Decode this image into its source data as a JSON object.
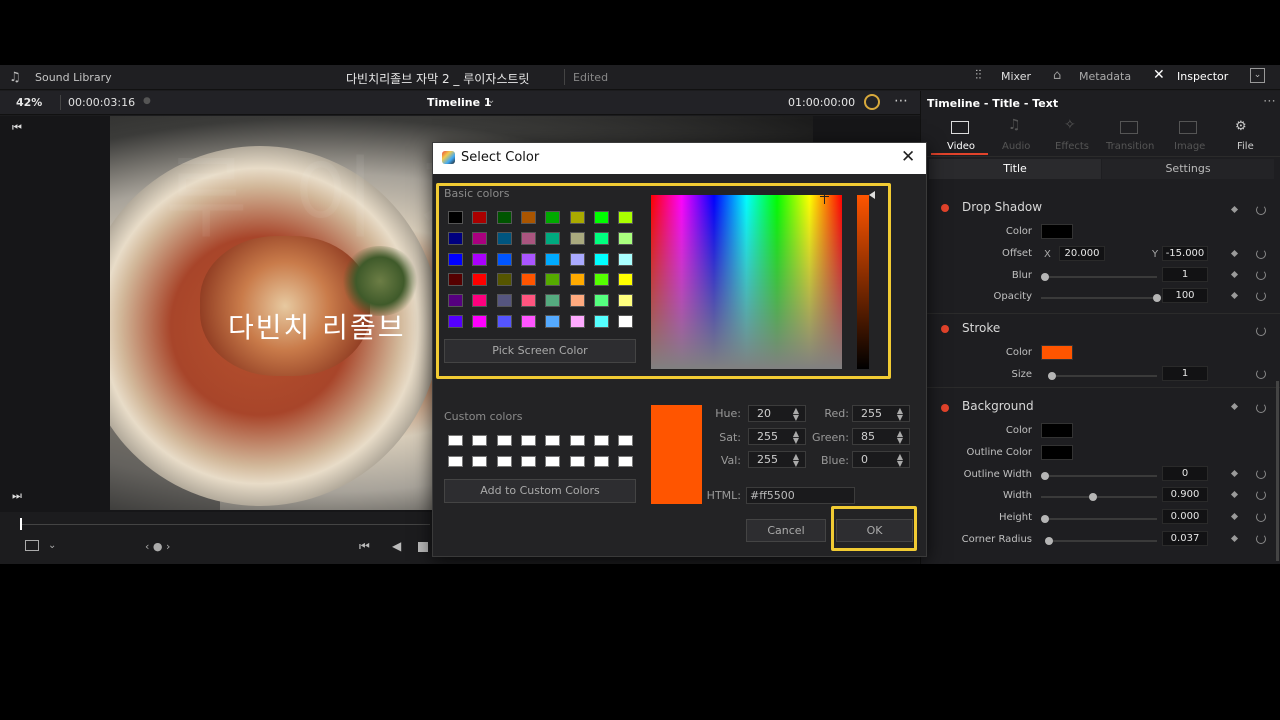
{
  "topbar": {
    "sound_library": "Sound Library",
    "project_title": "다빈치리졸브 자막 2 _ 루이자스트릿",
    "edited": "Edited",
    "mixer": "Mixer",
    "metadata": "Metadata",
    "inspector": "Inspector"
  },
  "viewer_bar": {
    "zoom": "42%",
    "timecode_left": "00:00:03:16",
    "timeline_name": "Timeline 1",
    "timecode_right": "01:00:00:00"
  },
  "video": {
    "overlay_text": "다빈치 리졸브",
    "watermark": "루이자스트릿"
  },
  "inspector": {
    "header": "Timeline - Title - Text",
    "tabs": [
      "Video",
      "Audio",
      "Effects",
      "Transition",
      "Image",
      "File"
    ],
    "subtabs": [
      "Title",
      "Settings"
    ],
    "drop_shadow": {
      "title": "Drop Shadow",
      "color_label": "Color",
      "color": "#000000",
      "offset_label": "Offset",
      "x_label": "X",
      "x_value": "20.000",
      "y_label": "Y",
      "y_value": "-15.000",
      "blur_label": "Blur",
      "blur_value": "1",
      "opacity_label": "Opacity",
      "opacity_value": "100"
    },
    "stroke": {
      "title": "Stroke",
      "color_label": "Color",
      "color": "#ff5500",
      "size_label": "Size",
      "size_value": "1"
    },
    "background": {
      "title": "Background",
      "color_label": "Color",
      "color": "#000000",
      "outline_color_label": "Outline Color",
      "outline_color": "#000000",
      "outline_width_label": "Outline Width",
      "outline_width_value": "0",
      "width_label": "Width",
      "width_value": "0.900",
      "height_label": "Height",
      "height_value": "0.000",
      "corner_radius_label": "Corner Radius",
      "corner_radius_value": "0.037"
    }
  },
  "dialog": {
    "title": "Select Color",
    "basic_colors_label": "Basic colors",
    "basic_colors": [
      [
        "#000000",
        "#aa0000",
        "#005500",
        "#aa5500",
        "#00aa00",
        "#aaaa00",
        "#00ff00",
        "#aaff00"
      ],
      [
        "#00007f",
        "#aa007f",
        "#00557f",
        "#aa557f",
        "#00aa7f",
        "#aaaa7f",
        "#00ff7f",
        "#aaff7f"
      ],
      [
        "#0000ff",
        "#aa00ff",
        "#0055ff",
        "#aa55ff",
        "#00aaff",
        "#aaaaff",
        "#00ffff",
        "#aaffff"
      ],
      [
        "#550000",
        "#ff0000",
        "#555500",
        "#ff5500",
        "#55aa00",
        "#ffaa00",
        "#55ff00",
        "#ffff00"
      ],
      [
        "#55007f",
        "#ff007f",
        "#55557f",
        "#ff557f",
        "#55aa7f",
        "#ffaa7f",
        "#55ff7f",
        "#ffff7f"
      ],
      [
        "#5500ff",
        "#ff00ff",
        "#5555ff",
        "#ff55ff",
        "#55aaff",
        "#ffaaff",
        "#55ffff",
        "#ffffff"
      ]
    ],
    "pick_screen_color": "Pick Screen Color",
    "custom_colors_label": "Custom colors",
    "add_custom": "Add to Custom Colors",
    "current_color": "#ff5500",
    "hue_label": "Hue:",
    "hue": "20",
    "sat_label": "Sat:",
    "sat": "255",
    "val_label": "Val:",
    "val": "255",
    "red_label": "Red:",
    "red": "255",
    "green_label": "Green:",
    "green": "85",
    "blue_label": "Blue:",
    "blue": "0",
    "html_label": "HTML:",
    "html": "#ff5500",
    "cancel": "Cancel",
    "ok": "OK",
    "highlight_color": "#f1cb33"
  }
}
